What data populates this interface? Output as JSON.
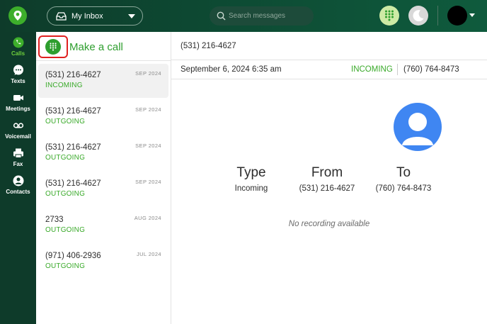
{
  "topbar": {
    "inbox_label": "My Inbox",
    "search_placeholder": "Search messages"
  },
  "nav": {
    "items": [
      {
        "label": "Calls",
        "icon": "phone-icon",
        "active": true
      },
      {
        "label": "Texts",
        "icon": "chat-icon",
        "active": false
      },
      {
        "label": "Meetings",
        "icon": "video-icon",
        "active": false
      },
      {
        "label": "Voicemail",
        "icon": "voicemail-icon",
        "active": false
      },
      {
        "label": "Fax",
        "icon": "fax-icon",
        "active": false
      },
      {
        "label": "Contacts",
        "icon": "contact-icon",
        "active": false
      }
    ]
  },
  "calllist": {
    "make_call_label": "Make a call",
    "rows": [
      {
        "number": "(531) 216-4627",
        "direction": "INCOMING",
        "date": "SEP 2024"
      },
      {
        "number": "(531) 216-4627",
        "direction": "OUTGOING",
        "date": "SEP 2024"
      },
      {
        "number": "(531) 216-4627",
        "direction": "OUTGOING",
        "date": "SEP 2024"
      },
      {
        "number": "(531) 216-4627",
        "direction": "OUTGOING",
        "date": "SEP 2024"
      },
      {
        "number": "2733",
        "direction": "OUTGOING",
        "date": "AUG 2024"
      },
      {
        "number": "(971) 406-2936",
        "direction": "OUTGOING",
        "date": "JUL 2024"
      }
    ]
  },
  "detail": {
    "header_number": "(531) 216-4627",
    "datetime": "September 6, 2024 6:35 am",
    "status": "INCOMING",
    "to_number": "(760) 764-8473",
    "type_title": "Type",
    "type_value": "Incoming",
    "from_title": "From",
    "from_value": "(531) 216-4627",
    "to_title": "To",
    "to_value": "(760) 764-8473",
    "no_recording": "No recording available"
  },
  "colors": {
    "brand_green": "#3dae2b",
    "dark_green": "#0e3b2a",
    "accent_blue": "#3f86f2",
    "highlight_red": "#e02020"
  }
}
